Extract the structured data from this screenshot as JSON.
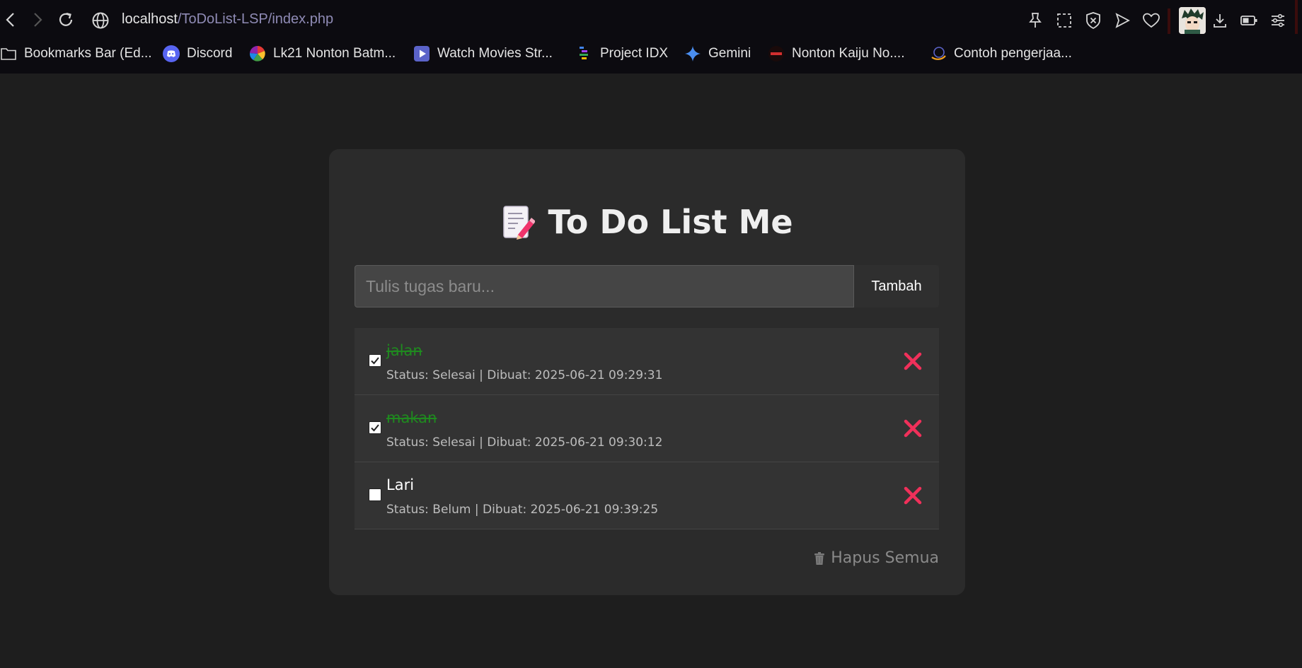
{
  "browser": {
    "url_host": "localhost",
    "url_path": "/ToDoList-LSP/index.php",
    "bookmarks": [
      {
        "label": "Bookmarks Bar (Ed...",
        "icon": "folder-icon"
      },
      {
        "label": "Discord",
        "icon": "discord-icon"
      },
      {
        "label": "Lk21 Nonton Batm...",
        "icon": "lk21-icon"
      },
      {
        "label": "Watch Movies Str...",
        "icon": "play-icon"
      },
      {
        "label": "Project IDX",
        "icon": "idx-icon"
      },
      {
        "label": "Gemini",
        "icon": "gemini-icon"
      },
      {
        "label": "Nonton Kaiju No....",
        "icon": "kaiju-icon"
      },
      {
        "label": "Contoh pengerjaa...",
        "icon": "site-icon"
      }
    ]
  },
  "app": {
    "title": "To Do List Me",
    "title_icon": "memo-icon",
    "input_placeholder": "Tulis tugas baru...",
    "input_value": "",
    "add_label": "Tambah",
    "clear_label": "Hapus Semua",
    "tasks": [
      {
        "name": "jalan",
        "done": true,
        "meta": "Status: Selesai | Dibuat: 2025-06-21 09:29:31"
      },
      {
        "name": "makan",
        "done": true,
        "meta": "Status: Selesai | Dibuat: 2025-06-21 09:30:12"
      },
      {
        "name": "Lari",
        "done": false,
        "meta": "Status: Belum | Dibuat: 2025-06-21 09:39:25"
      }
    ]
  },
  "colors": {
    "done_text": "#1f8a1f",
    "delete_icon": "#f0305a",
    "card_bg": "#2b2b2b",
    "page_bg": "#1e1e1e"
  }
}
